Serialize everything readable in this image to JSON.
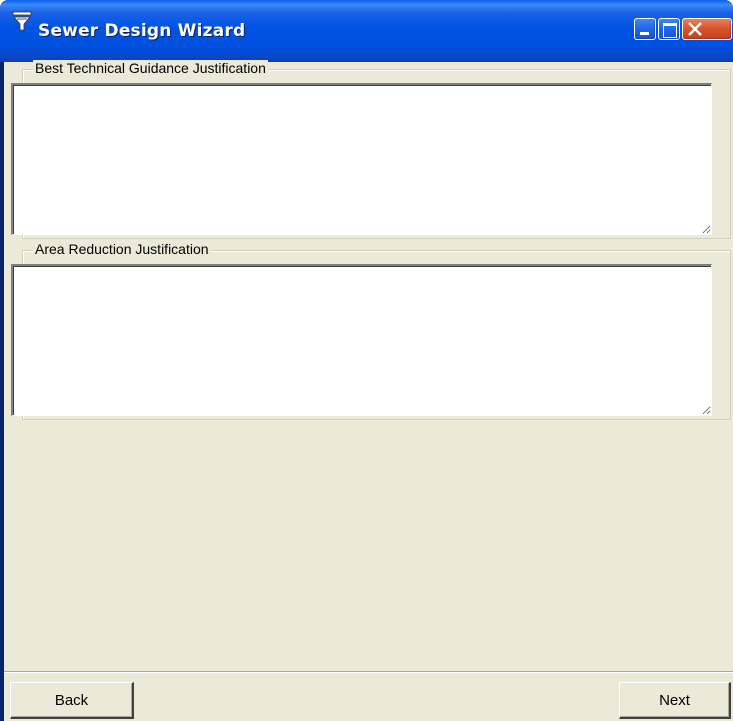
{
  "window": {
    "title": "Sewer Design Wizard",
    "icon": "funnel-icon",
    "controls": [
      "minimize-icon",
      "maximize-icon",
      "close-icon"
    ]
  },
  "sections": [
    {
      "legend": "Best Technical Guidance Justification",
      "value": ""
    },
    {
      "legend": "Area Reduction Justification",
      "value": ""
    }
  ],
  "footer": {
    "back_label": "Back",
    "next_label": "Next"
  },
  "colors": {
    "titlebar": "#0054e3",
    "client_bg": "#ece9d8",
    "close_button": "#d6532d"
  }
}
